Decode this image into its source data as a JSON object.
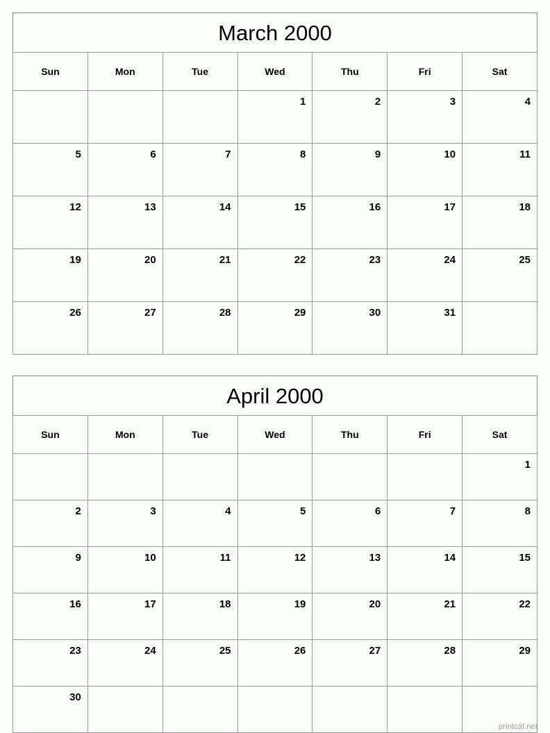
{
  "page": {
    "watermark": "printcal.net",
    "background_color": "#fbfdfa",
    "border_color": "#9a9a9a",
    "text_color": "#000000",
    "watermark_color": "#9a9a9a"
  },
  "weekday_headers": [
    "Sun",
    "Mon",
    "Tue",
    "Wed",
    "Thu",
    "Fri",
    "Sat"
  ],
  "months": [
    {
      "id": "march",
      "title": "March 2000",
      "weeks": [
        [
          "",
          "",
          "",
          "1",
          "2",
          "3",
          "4"
        ],
        [
          "5",
          "6",
          "7",
          "8",
          "9",
          "10",
          "11"
        ],
        [
          "12",
          "13",
          "14",
          "15",
          "16",
          "17",
          "18"
        ],
        [
          "19",
          "20",
          "21",
          "22",
          "23",
          "24",
          "25"
        ],
        [
          "26",
          "27",
          "28",
          "29",
          "30",
          "31",
          ""
        ]
      ]
    },
    {
      "id": "april",
      "title": "April 2000",
      "weeks": [
        [
          "",
          "",
          "",
          "",
          "",
          "",
          "1"
        ],
        [
          "2",
          "3",
          "4",
          "5",
          "6",
          "7",
          "8"
        ],
        [
          "9",
          "10",
          "11",
          "12",
          "13",
          "14",
          "15"
        ],
        [
          "16",
          "17",
          "18",
          "19",
          "20",
          "21",
          "22"
        ],
        [
          "23",
          "24",
          "25",
          "26",
          "27",
          "28",
          "29"
        ],
        [
          "30",
          "",
          "",
          "",
          "",
          "",
          ""
        ]
      ]
    }
  ]
}
